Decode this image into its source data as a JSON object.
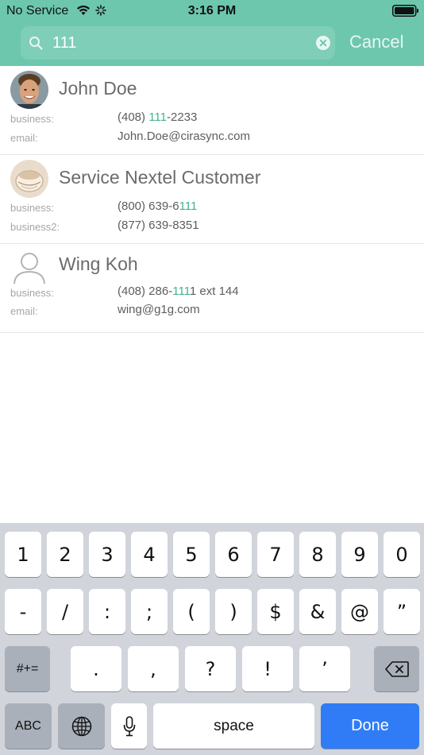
{
  "status_bar": {
    "carrier": "No Service",
    "time": "3:16 PM"
  },
  "search": {
    "query": "111",
    "placeholder": "",
    "cancel_label": "Cancel"
  },
  "colors": {
    "header_bg": "#6cc7ad",
    "highlight": "#41b48e",
    "done_key": "#2f7cf6"
  },
  "contacts": [
    {
      "name": "John Doe",
      "avatar": "photo",
      "fields": [
        {
          "label": "business:",
          "value_parts": [
            "(408) ",
            "111",
            "-2233"
          ]
        },
        {
          "label": "email:",
          "value_parts": [
            "John.Doe@cirasync.com"
          ]
        }
      ]
    },
    {
      "name": "Service Nextel Customer",
      "avatar": "photo",
      "fields": [
        {
          "label": "business:",
          "value_parts": [
            "(800) 639-6",
            "111",
            ""
          ]
        },
        {
          "label": "business2:",
          "value_parts": [
            "(877) 639-8351"
          ]
        }
      ]
    },
    {
      "name": "Wing Koh",
      "avatar": "person-placeholder-icon",
      "fields": [
        {
          "label": "business:",
          "value_parts": [
            "(408) 286-",
            "111",
            "1 ext 144"
          ]
        },
        {
          "label": "email:",
          "value_parts": [
            "wing@g1g.com"
          ]
        }
      ]
    }
  ],
  "keyboard": {
    "row1": [
      "1",
      "2",
      "3",
      "4",
      "5",
      "6",
      "7",
      "8",
      "9",
      "0"
    ],
    "row2": [
      "-",
      "/",
      ":",
      ";",
      "(",
      ")",
      "$",
      "&",
      "@",
      "”"
    ],
    "row3_mode_label": "#+=",
    "row3": [
      ".",
      ",",
      "?",
      "!",
      "’"
    ],
    "abc_label": "ABC",
    "space_label": "space",
    "done_label": "Done",
    "icons": [
      "backspace-icon",
      "globe-icon",
      "microphone-icon"
    ]
  }
}
